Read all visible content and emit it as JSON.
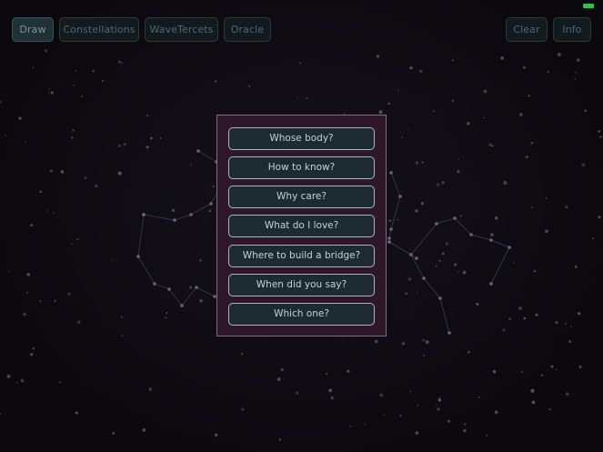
{
  "colors": {
    "background": "#0d0a10",
    "star": "#5a5560",
    "constellation_line": "#2f3540",
    "dialog_background": "#2e1729",
    "dialog_border": "#7c6d80",
    "button_background": "#1d2a31",
    "button_border": "#a9b6bd",
    "battery": "#2ec24a"
  },
  "status_bar": {
    "battery_icon": "battery-icon"
  },
  "toolbar": {
    "draw_label": "Draw",
    "constellations_label": "Constellations",
    "wavetercets_label": "WaveTercets",
    "oracle_label": "Oracle",
    "clear_label": "Clear",
    "info_label": "Info",
    "active_tab": "Draw"
  },
  "oracle_dialog": {
    "questions": [
      "Whose body?",
      "How to know?",
      "Why care?",
      "What do I love?",
      "Where to build a bridge?",
      "When did you say?",
      "Which one?"
    ]
  }
}
